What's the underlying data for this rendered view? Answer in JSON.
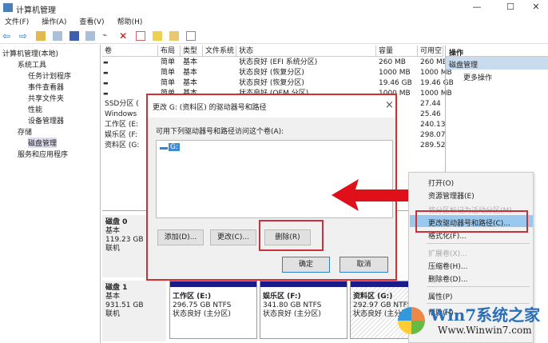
{
  "window": {
    "title": "计算机管理",
    "min": "—",
    "max": "☐",
    "close": "✕"
  },
  "menu": [
    "文件(F)",
    "操作(A)",
    "查看(V)",
    "帮助(H)"
  ],
  "tree": {
    "root": "计算机管理(本地)",
    "system_tools": "系统工具",
    "task_scheduler": "任务计划程序",
    "event_viewer": "事件查看器",
    "shared_folders": "共享文件夹",
    "performance": "性能",
    "device_manager": "设备管理器",
    "storage": "存储",
    "disk_management": "磁盘管理",
    "services": "服务和应用程序"
  },
  "table": {
    "headers": [
      "卷",
      "布局",
      "类型",
      "文件系统",
      "状态",
      "容量",
      "可用空"
    ],
    "rows": [
      [
        "",
        "简单",
        "基本",
        "",
        "状态良好 (EFI 系统分区)",
        "260 MB",
        "260 MB"
      ],
      [
        "",
        "简单",
        "基本",
        "",
        "状态良好 (恢复分区)",
        "1000 MB",
        "1000 MB"
      ],
      [
        "",
        "简单",
        "基本",
        "",
        "状态良好 (恢复分区)",
        "19.46 GB",
        "19.46 GB"
      ],
      [
        "",
        "简单",
        "基本",
        "",
        "状态良好 (OEM 分区)",
        "1000 MB",
        "1000 MB"
      ],
      [
        "SSD分区 (",
        "",
        "",
        "",
        "",
        "GB",
        "27.44"
      ],
      [
        "Windows",
        "",
        "",
        "",
        "",
        "GB",
        "25.46"
      ],
      [
        "工作区 (E:",
        "",
        "",
        "",
        "",
        "GB",
        "240.13"
      ],
      [
        "娱乐区 (F:",
        "",
        "",
        "",
        "",
        "GB",
        "298.07"
      ],
      [
        "资料区 (G:",
        "",
        "",
        "",
        "",
        "GB",
        "289.52"
      ]
    ]
  },
  "actions": {
    "header": "操作",
    "section": "磁盘管理",
    "more": "更多操作"
  },
  "disks": [
    {
      "name": "磁盘 0",
      "type": "基本",
      "size": "119.23 GB",
      "status": "联机"
    },
    {
      "name": "磁盘 1",
      "type": "基本",
      "size": "931.51 GB",
      "status": "联机"
    }
  ],
  "partitions": [
    {
      "name": "工作区  (E:)",
      "size": "296.75 GB NTFS",
      "status": "状态良好 (主分区)"
    },
    {
      "name": "娱乐区  (F:)",
      "size": "341.80 GB NTFS",
      "status": "状态良好 (主分区)"
    },
    {
      "name": "资料区  (G:)",
      "size": "292.97 GB NTFS",
      "status": "状态良好 (主分区)"
    }
  ],
  "dialog": {
    "title": "更改 G: (资料区) 的驱动器号和路径",
    "close": "×",
    "label": "可用下列驱动器号和路径访问这个卷(A):",
    "list_item": "G:",
    "add": "添加(D)...",
    "change": "更改(C)...",
    "remove": "删除(R)",
    "ok": "确定",
    "cancel": "取消"
  },
  "context_menu": [
    "打开(O)",
    "资源管理器(E)",
    "将分区标记为活动分区(M)",
    "更改驱动器号和路径(C)...",
    "格式化(F)...",
    "扩展卷(X)...",
    "压缩卷(H)...",
    "删除卷(D)...",
    "属性(P)",
    "帮助(H)"
  ],
  "watermark": {
    "brand": "Win7系统之家",
    "url": "Www.Winwin7.com"
  },
  "colors": {
    "highlight": "#d23030",
    "selection": "#99c9ef",
    "partition_bar": "#1a1a8a"
  }
}
